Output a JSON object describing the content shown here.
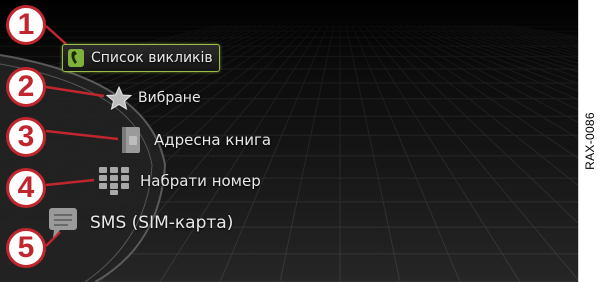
{
  "figure_code": "RAX-0086",
  "menu": {
    "items": [
      {
        "number": "1",
        "label": "Список викликів",
        "icon": "phone-icon",
        "selected": true
      },
      {
        "number": "2",
        "label": "Вибране",
        "icon": "star-icon",
        "selected": false
      },
      {
        "number": "3",
        "label": "Адресна книга",
        "icon": "address-book-icon",
        "selected": false
      },
      {
        "number": "4",
        "label": "Набрати номер",
        "icon": "keypad-icon",
        "selected": false
      },
      {
        "number": "5",
        "label": "SMS (SIM-карта)",
        "icon": "sms-icon",
        "selected": false
      }
    ]
  },
  "colors": {
    "selection_border": "#9bbf46",
    "phone_icon": "#7fb23a",
    "callout": "#c0262d",
    "text": "#e8e8e8"
  }
}
